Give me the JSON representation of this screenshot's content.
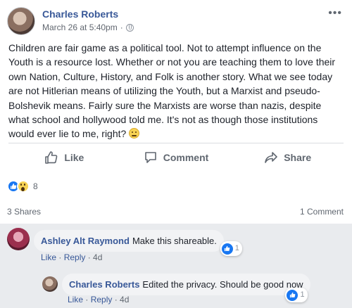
{
  "post": {
    "author": "Charles Roberts",
    "date": "March 26 at 5:40pm",
    "separator": "·",
    "text": "Children are fair game as a political tool. Not to attempt influence on the Youth is a resource lost. Whether or not you are teaching them to love their own Nation, Culture, History, and Folk is another story. What we see today are not Hitlerian means of utilizing the Youth, but a Marxist and pseudo-Bolshevik means. Fairly sure the Marxists are worse than nazis, despite what school and hollywood told me. It's not as though those institutions would ever lie to me, right?",
    "more_icon": "more-options-icon",
    "privacy_icon": "globe-icon"
  },
  "actions": {
    "like": "Like",
    "comment": "Comment",
    "share": "Share"
  },
  "reactions": {
    "count": "8",
    "types": [
      "like",
      "wow"
    ]
  },
  "stats": {
    "shares": "3 Shares",
    "comments": "1 Comment"
  },
  "comments": [
    {
      "name": "Ashley Alt Raymond",
      "text": "Make this shareable.",
      "like_label": "Like",
      "reply_label": "Reply",
      "age": "4d",
      "reaction_count": "1"
    }
  ],
  "replies": [
    {
      "name": "Charles Roberts",
      "text": "Edited the privacy. Should be good now",
      "like_label": "Like",
      "reply_label": "Reply",
      "age": "4d",
      "reaction_count": "1"
    }
  ],
  "colors": {
    "link": "#385898",
    "like_blue": "#1877f2",
    "secondary_text": "#606770",
    "background": "#e9ebee"
  }
}
